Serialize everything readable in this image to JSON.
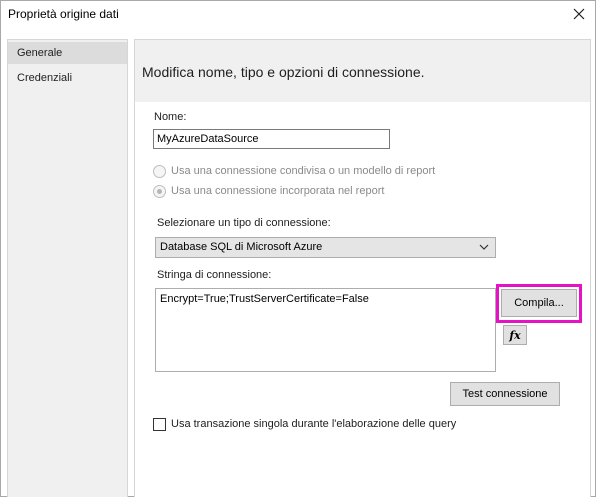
{
  "window": {
    "title": "Proprietà origine dati",
    "close_icon": "close-icon"
  },
  "sidebar": {
    "items": [
      {
        "label": "Generale",
        "selected": true
      },
      {
        "label": "Credenziali",
        "selected": false
      }
    ]
  },
  "main": {
    "header": "Modifica nome, tipo e opzioni di connessione.",
    "name_label": "Nome:",
    "name_value": "MyAzureDataSource",
    "radio_shared": "Usa una connessione condivisa o un modello di report",
    "radio_embedded": "Usa una connessione incorporata nel report",
    "conn_type_label": "Selezionare un tipo di connessione:",
    "conn_type_value": "Database SQL di Microsoft Azure",
    "conn_string_label": "Stringa di connessione:",
    "conn_string_value": "Encrypt=True;TrustServerCertificate=False",
    "build_button": "Compila...",
    "expression_button": "fx",
    "test_button": "Test connessione",
    "single_transaction_label": "Usa transazione singola durante l'elaborazione delle query"
  },
  "colors": {
    "highlight": "#e413c6",
    "panel_bg": "#f0f0f0",
    "selected_item_bg": "#dcdcdc"
  }
}
